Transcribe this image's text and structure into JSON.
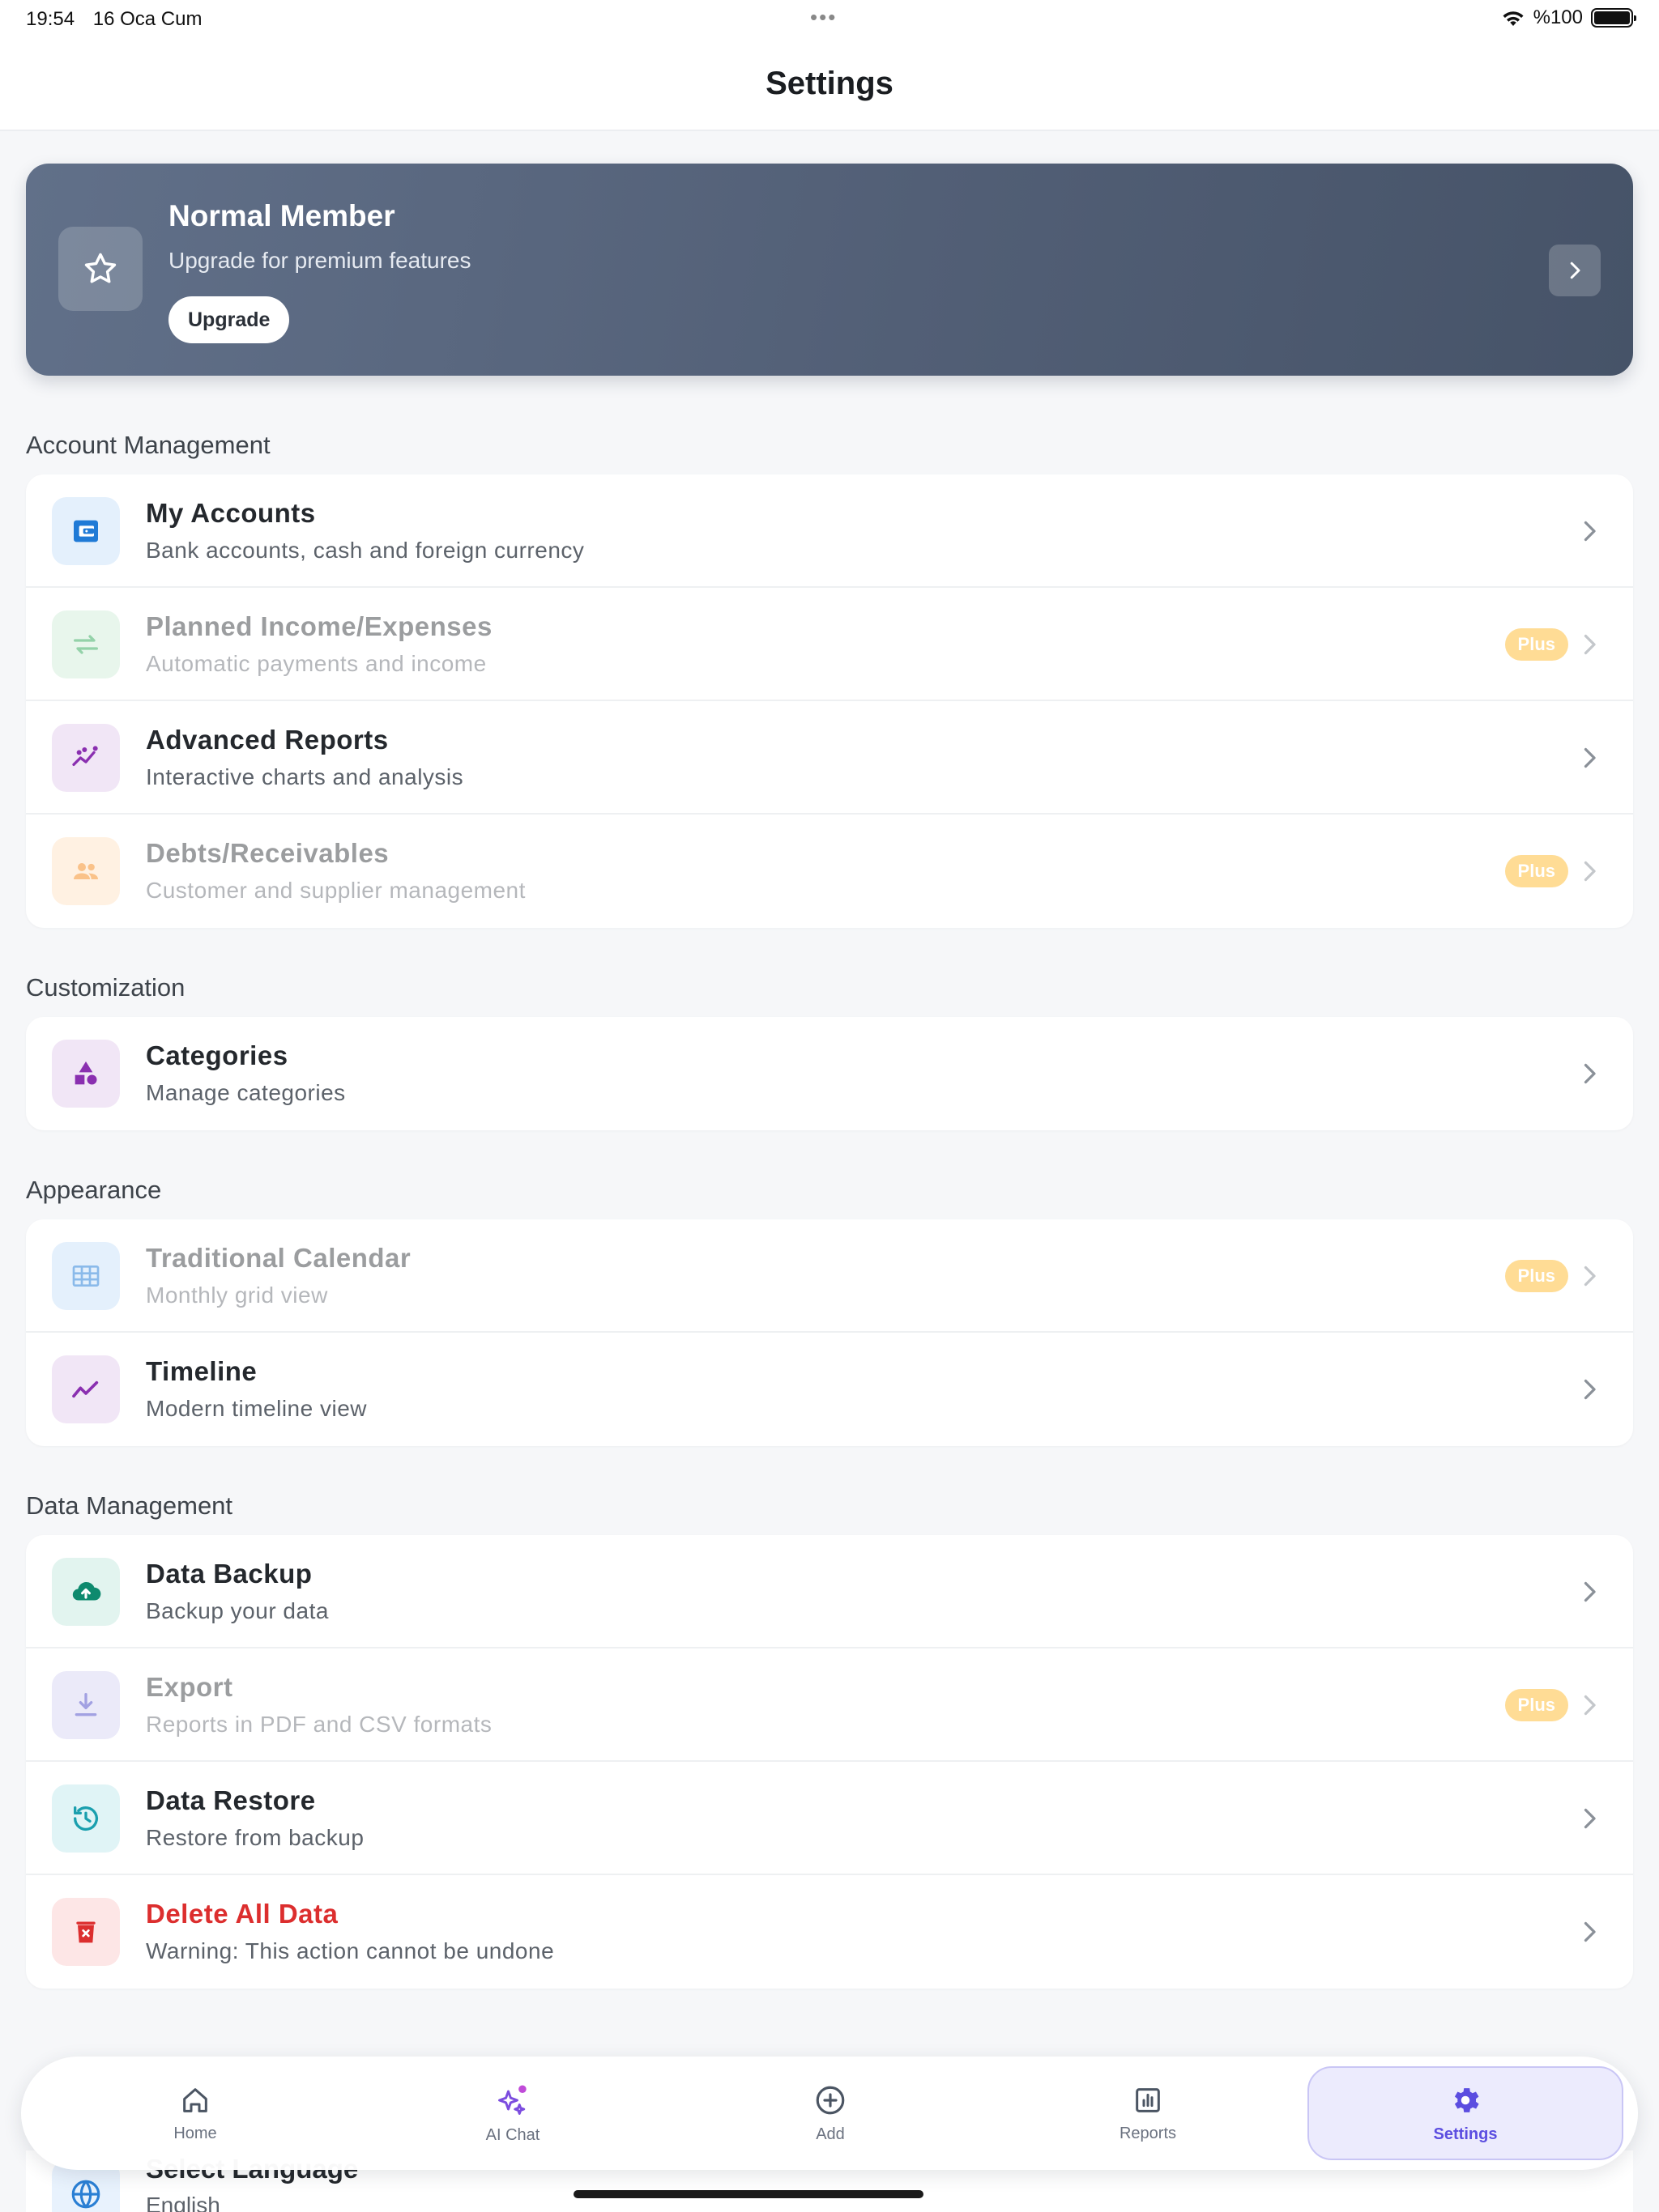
{
  "status_bar": {
    "time": "19:54",
    "date": "16 Oca Cum",
    "battery_text": "%100",
    "battery_level": 1.0
  },
  "header": {
    "title": "Settings"
  },
  "membership": {
    "title": "Normal Member",
    "subtitle": "Upgrade for premium features",
    "button": "Upgrade"
  },
  "sections": [
    {
      "title": "Account Management",
      "items": [
        {
          "title": "My Accounts",
          "subtitle": "Bank accounts, cash and foreign currency",
          "icon": "wallet-icon",
          "enabled": true,
          "badge": ""
        },
        {
          "title": "Planned Income/Expenses",
          "subtitle": "Automatic payments and income",
          "icon": "repeat-icon",
          "enabled": false,
          "badge": "Plus"
        },
        {
          "title": "Advanced Reports",
          "subtitle": "Interactive charts and analysis",
          "icon": "analytics-icon",
          "enabled": true,
          "badge": ""
        },
        {
          "title": "Debts/Receivables",
          "subtitle": "Customer and supplier management",
          "icon": "people-icon",
          "enabled": false,
          "badge": "Plus"
        }
      ]
    },
    {
      "title": "Customization",
      "items": [
        {
          "title": "Categories",
          "subtitle": "Manage categories",
          "icon": "shapes-icon",
          "enabled": true,
          "badge": ""
        }
      ]
    },
    {
      "title": "Appearance",
      "items": [
        {
          "title": "Traditional Calendar",
          "subtitle": "Monthly grid view",
          "icon": "grid-icon",
          "enabled": false,
          "badge": "Plus"
        },
        {
          "title": "Timeline",
          "subtitle": "Modern timeline view",
          "icon": "timeline-icon",
          "enabled": true,
          "badge": ""
        }
      ]
    },
    {
      "title": "Data Management",
      "items": [
        {
          "title": "Data Backup",
          "subtitle": "Backup your data",
          "icon": "cloud-upload-icon",
          "enabled": true,
          "badge": ""
        },
        {
          "title": "Export",
          "subtitle": "Reports in PDF and CSV formats",
          "icon": "download-icon",
          "enabled": false,
          "badge": "Plus"
        },
        {
          "title": "Data Restore",
          "subtitle": "Restore from backup",
          "icon": "restore-icon",
          "enabled": true,
          "badge": ""
        },
        {
          "title": "Delete All Data",
          "subtitle": "Warning: This action cannot be undone",
          "icon": "trash-icon",
          "enabled": true,
          "badge": "",
          "danger": true
        }
      ]
    }
  ],
  "partial_row": {
    "title": "Select Language",
    "subtitle": "English"
  },
  "tabbar": [
    {
      "label": "Home",
      "icon": "home-icon",
      "active": false
    },
    {
      "label": "AI Chat",
      "icon": "sparkles-icon",
      "active": false
    },
    {
      "label": "Add",
      "icon": "plus-circle-icon",
      "active": false
    },
    {
      "label": "Reports",
      "icon": "bar-chart-icon",
      "active": false
    },
    {
      "label": "Settings",
      "icon": "gear-icon",
      "active": true
    }
  ],
  "colors": {
    "accent": "#5b4de0",
    "danger": "#dc2e2e",
    "plus_badge": "#ffd98a",
    "card_gradient_start": "#617089",
    "card_gradient_end": "#465368"
  }
}
